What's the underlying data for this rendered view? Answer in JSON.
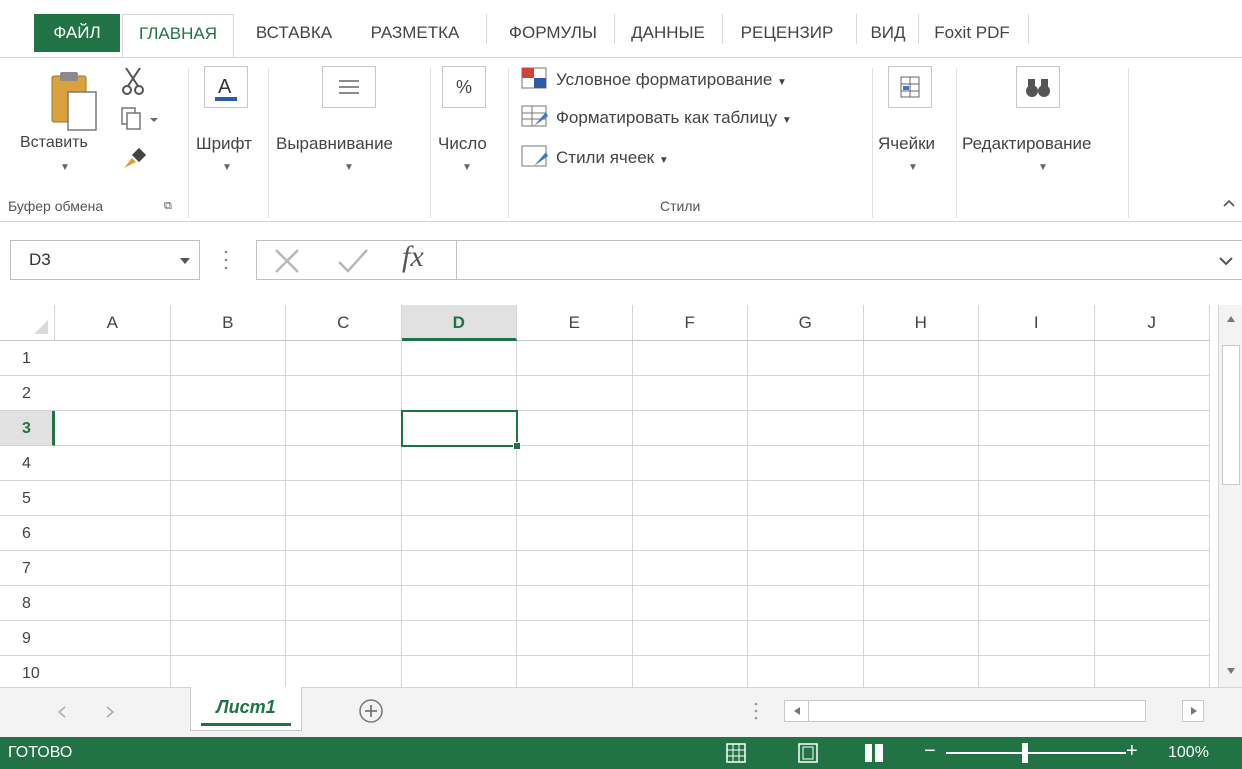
{
  "tabs": {
    "file": "ФАЙЛ",
    "home": "ГЛАВНАЯ",
    "insert": "ВСТАВКА",
    "layout": "РАЗМЕТКА",
    "formulas": "ФОРМУЛЫ",
    "data": "ДАННЫЕ",
    "review": "РЕЦЕНЗИР",
    "view": "ВИД",
    "foxit": "Foxit PDF"
  },
  "ribbon": {
    "paste_label": "Вставить",
    "clipboard_group": "Буфер обмена",
    "font_label": "Шрифт",
    "alignment_label": "Выравнивание",
    "number_label": "Число",
    "number_symbol": "%",
    "conditional_formatting": "Условное форматирование",
    "format_as_table": "Форматировать как таблицу",
    "cell_styles": "Стили ячеек",
    "styles_group": "Стили",
    "cells_label": "Ячейки",
    "editing_label": "Редактирование"
  },
  "formula_bar": {
    "name_box": "D3",
    "fx_symbol": "fx",
    "formula": ""
  },
  "grid": {
    "columns": [
      "A",
      "B",
      "C",
      "D",
      "E",
      "F",
      "G",
      "H",
      "I",
      "J"
    ],
    "rows": [
      "1",
      "2",
      "3",
      "4",
      "5",
      "6",
      "7",
      "8",
      "9",
      "10"
    ],
    "active_cell": "D3"
  },
  "sheets": {
    "active_sheet": "Лист1"
  },
  "status": {
    "ready": "ГОТОВО",
    "zoom": "100%"
  },
  "colors": {
    "accent": "#217346",
    "header_selected": "#e1e1e1",
    "gridline": "#d4d4d4"
  }
}
